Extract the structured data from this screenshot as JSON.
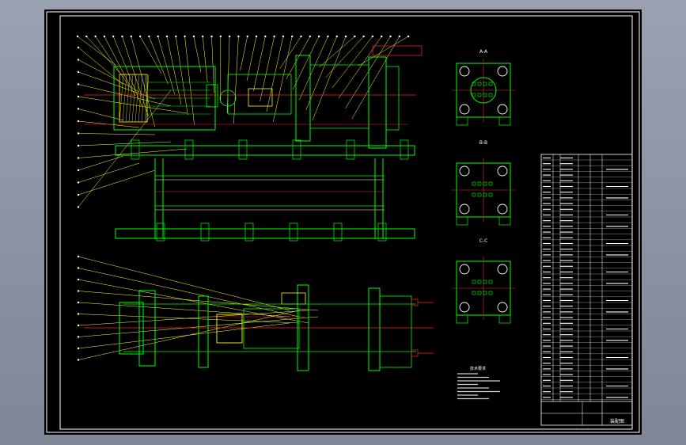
{
  "drawing": {
    "colors": {
      "background": "#000000",
      "border": "#ffffff",
      "part_outline": "#00ff00",
      "centerline": "#ff2020",
      "leader": "#ffff40",
      "hatch": "#ffff00",
      "viewport_bg": "#8f96a6"
    },
    "section_views": [
      "A-A",
      "B-B",
      "C-C"
    ],
    "title_block_caption": "装配图",
    "notes_title": "技术要求"
  }
}
